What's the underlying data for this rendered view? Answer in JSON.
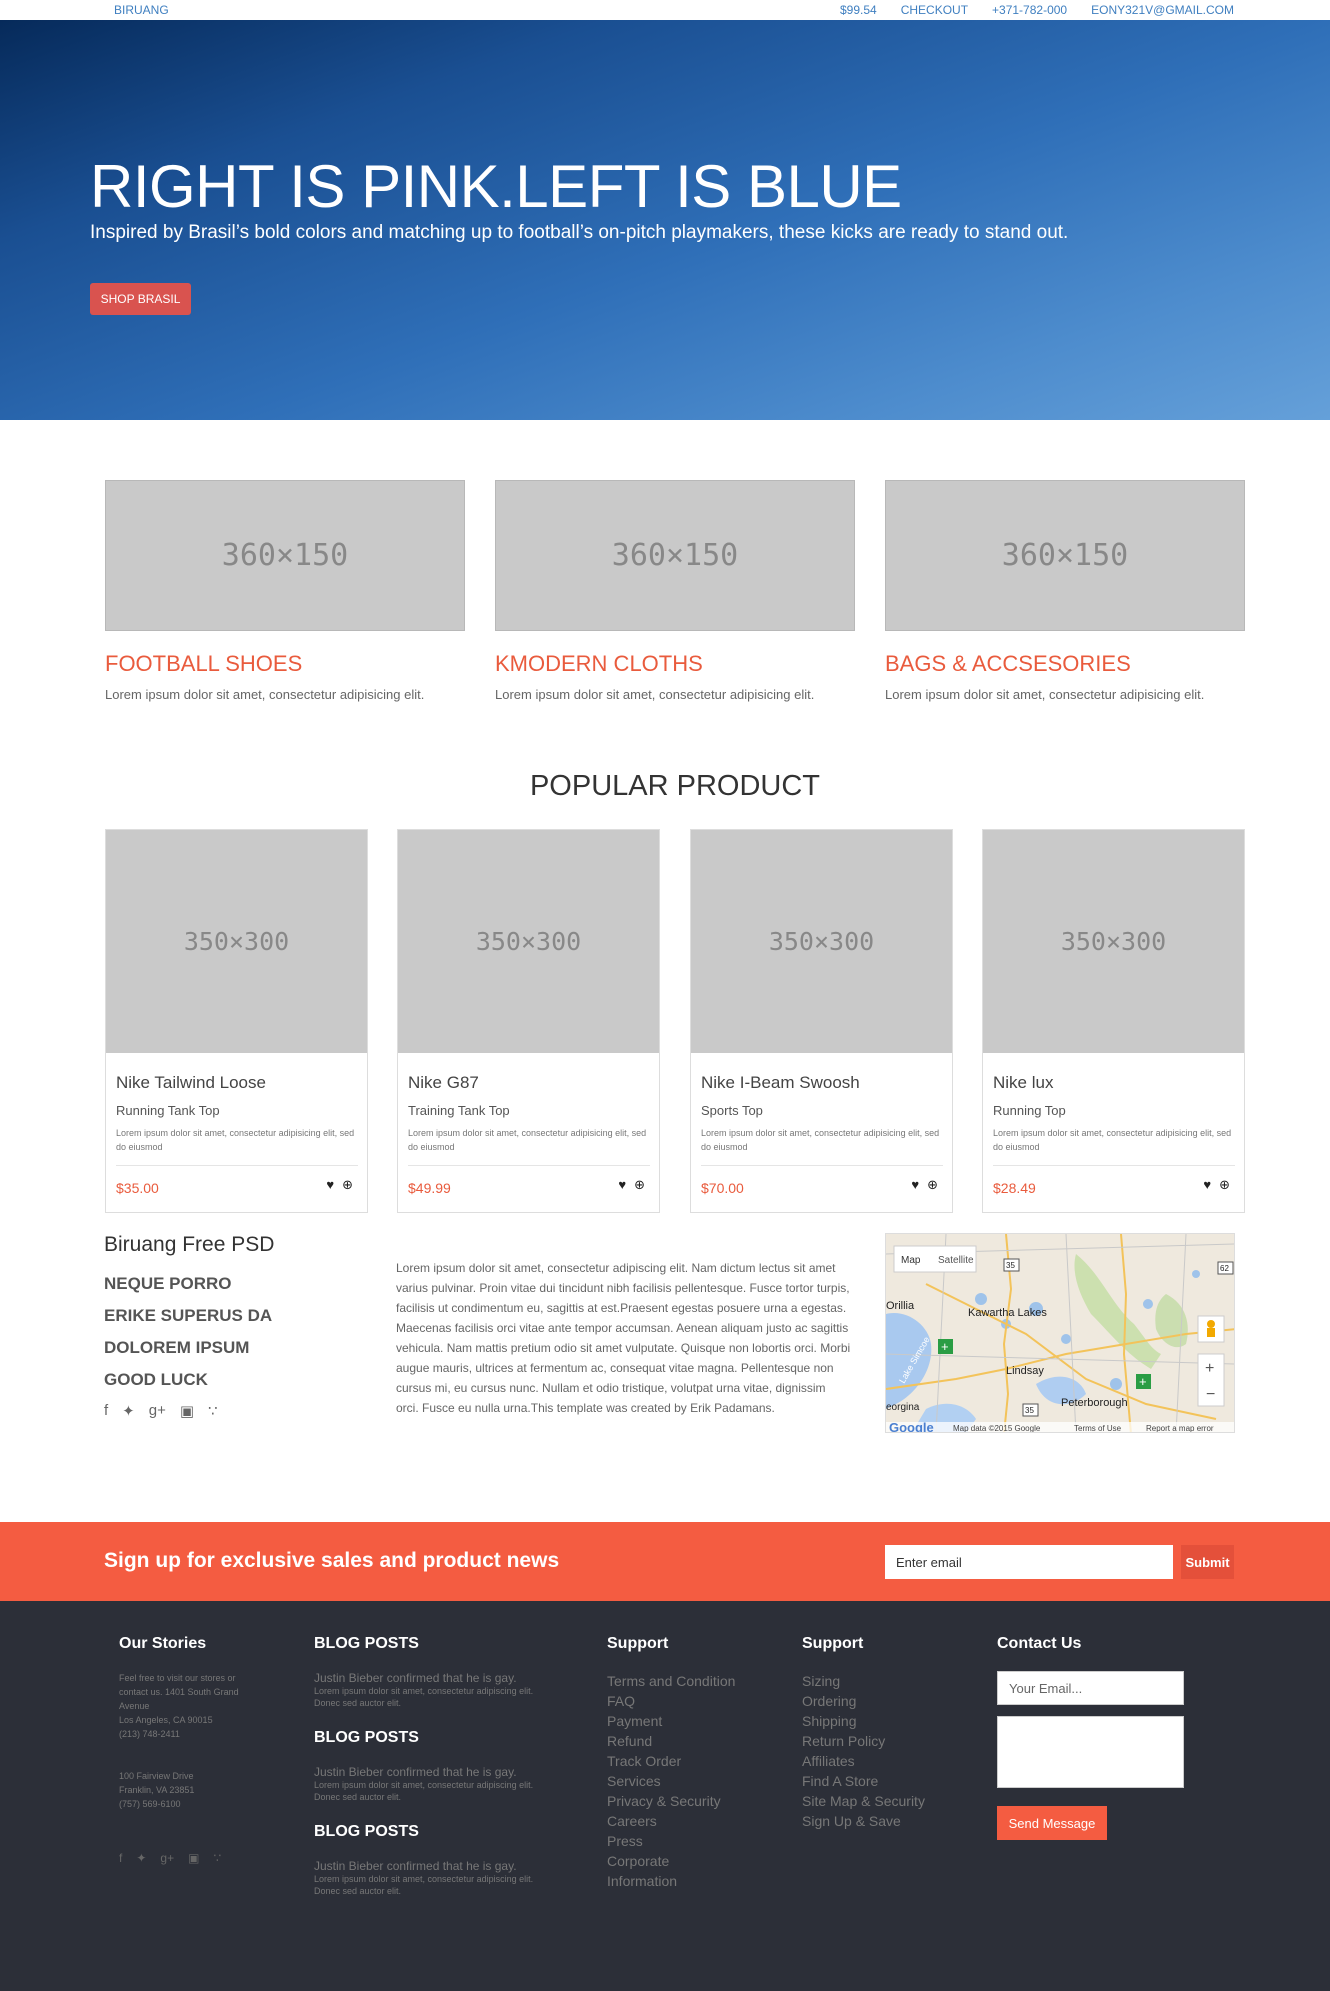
{
  "topbar": {
    "brand": "BIRUANG",
    "links": [
      "$99.54",
      "CHECKOUT",
      "+371-782-000",
      "EONY321V@GMAIL.COM"
    ]
  },
  "hero": {
    "title": "RIGHT IS PINK.LEFT IS BLUE",
    "subtitle": "Inspired by Brasil’s bold colors and matching up to football’s on-pitch playmakers, these kicks are ready to stand out.",
    "button": "SHOP BRASIL"
  },
  "categories": [
    {
      "image": "360×150",
      "title": "FOOTBALL SHOES",
      "text": "Lorem ipsum dolor sit amet, consectetur adipisicing elit."
    },
    {
      "image": "360×150",
      "title": "KMODERN CLOTHS",
      "text": "Lorem ipsum dolor sit amet, consectetur adipisicing elit."
    },
    {
      "image": "360×150",
      "title": "BAGS & ACCSESORIES",
      "text": "Lorem ipsum dolor sit amet, consectetur adipisicing elit."
    }
  ],
  "popular": {
    "title": "POPULAR PRODUCT",
    "products": [
      {
        "image": "350×300",
        "name": "Nike Tailwind Loose",
        "sub": "Running Tank Top",
        "desc": "Lorem ipsum dolor sit amet, consectetur adipisicing elit, sed do eiusmod",
        "price": "$35.00"
      },
      {
        "image": "350×300",
        "name": "Nike G87",
        "sub": "Training Tank Top",
        "desc": "Lorem ipsum dolor sit amet, consectetur adipisicing elit, sed do eiusmod",
        "price": "$49.99"
      },
      {
        "image": "350×300",
        "name": "Nike I-Beam Swoosh",
        "sub": "Sports Top",
        "desc": "Lorem ipsum dolor sit amet, consectetur adipisicing elit, sed do eiusmod",
        "price": "$70.00"
      },
      {
        "image": "350×300",
        "name": "Nike lux",
        "sub": "Running Top",
        "desc": "Lorem ipsum dolor sit amet, consectetur adipisicing elit, sed do eiusmod",
        "price": "$28.49"
      }
    ]
  },
  "info": {
    "title": "Biruang Free PSD",
    "links": [
      "NEQUE PORRO",
      "ERIKE SUPERUS DA",
      "DOLOREM IPSUM",
      "GOOD LUCK"
    ],
    "paragraph": "Lorem ipsum dolor sit amet, consectetur adipiscing elit. Nam dictum lectus sit amet varius pulvinar. Proin vitae dui tincidunt nibh facilisis pellentesque. Fusce tortor turpis, facilisis ut condimentum eu, sagittis at est.Praesent egestas posuere urna a egestas. Maecenas facilisis orci vitae ante tempor accumsan. Aenean aliquam justo ac sagittis vehicula. Nam mattis pretium odio sit amet vulputate. Quisque non lobortis orci. Morbi augue mauris, ultrices at fermentum ac, consequat vitae magna. Pellentesque non cursus mi, eu cursus nunc. Nullam et odio tristique, volutpat urna vitae, dignissim orci. Fusce eu nulla urna.This template was created by Erik Padamans."
  },
  "map": {
    "tab_map": "Map",
    "tab_satellite": "Satellite",
    "labels": [
      "Orillia",
      "Kawartha Lakes",
      "Lindsay",
      "Peterborough",
      "Lake Simcoe",
      "eorgina"
    ],
    "road_shields": [
      "35",
      "62",
      "35"
    ],
    "attribution": "Map data ©2015 Google",
    "terms": "Terms of Use",
    "report": "Report a map error",
    "logo": "Google"
  },
  "signup": {
    "title": "Sign up for exclusive sales and product news",
    "placeholder": "Enter email",
    "button": "Submit"
  },
  "footer": {
    "stories_title": "Our Stories",
    "stories_text1": "Feel free to visit our stores or contact us. 1401 South Grand Avenue",
    "stories_text2": "Los Angeles, CA 90015",
    "stories_text3": "(213) 748-2411",
    "stories_text4": "100 Fairview Drive",
    "stories_text5": "Franklin, VA 23851",
    "stories_text6": "(757) 569-6100",
    "blogs": [
      {
        "title": "BLOG POSTS",
        "headline": "Justin Bieber confirmed that he is gay.",
        "text": "Lorem ipsum dolor sit amet, consectetur adipiscing elit. Donec sed auctor elit."
      },
      {
        "title": "BLOG POSTS",
        "headline": "Justin Bieber confirmed that he is gay.",
        "text": "Lorem ipsum dolor sit amet, consectetur adipiscing elit. Donec sed auctor elit."
      },
      {
        "title": "BLOG POSTS",
        "headline": "Justin Bieber confirmed that he is gay.",
        "text": "Lorem ipsum dolor sit amet, consectetur adipiscing elit. Donec sed auctor elit."
      }
    ],
    "support1_title": "Support",
    "support1": [
      "Terms and Condition",
      "FAQ",
      "Payment",
      "Refund",
      "Track Order",
      "Services",
      "Privacy & Security",
      "Careers",
      "Press",
      "Corporate",
      "Information"
    ],
    "support2_title": "Support",
    "support2": [
      "Sizing",
      "Ordering",
      "Shipping",
      "Return Policy",
      "Affiliates",
      "Find A Store",
      "Site Map & Security",
      "Sign Up & Save"
    ],
    "contact_title": "Contact Us",
    "contact_placeholder": "Your Email...",
    "contact_button": "Send Message"
  }
}
